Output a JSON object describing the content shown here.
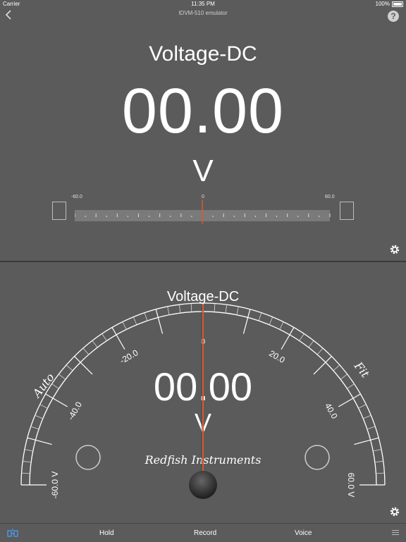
{
  "status_bar": {
    "carrier": "Carrier",
    "time": "11:35 PM",
    "battery": "100%"
  },
  "nav": {
    "title": "IDVM-510 emulator",
    "help_label": "?"
  },
  "top_panel": {
    "mode": "Voltage-DC",
    "reading": "00.00",
    "unit": "V",
    "bar": {
      "min_label": "-60.0",
      "center_label": "0",
      "max_label": "60.0",
      "min": -60,
      "max": 60,
      "value": 0
    }
  },
  "gauge": {
    "mode": "Voltage-DC",
    "reading": "00.00",
    "unit": "V",
    "left_mode": "Auto",
    "right_mode": "Fit",
    "brand": "Redfish Instruments",
    "center_label": "0",
    "min": -60,
    "max": 60,
    "value": 0,
    "tick_labels": [
      "-60.0 V",
      "-40.0",
      "-20.0",
      "20.0",
      "40.0",
      "60.0 V"
    ],
    "tick_values": [
      -60,
      -40,
      -20,
      20,
      40,
      60
    ]
  },
  "tabs": {
    "hold": "Hold",
    "record": "Record",
    "voice": "Voice"
  },
  "colors": {
    "background": "#5b5b5b",
    "needle": "#e0552d"
  },
  "icons": {
    "back": "chevron-left-icon",
    "help": "question-icon",
    "settings": "gear-icon",
    "device": "bluetooth-device-icon",
    "menu": "menu-icon"
  }
}
